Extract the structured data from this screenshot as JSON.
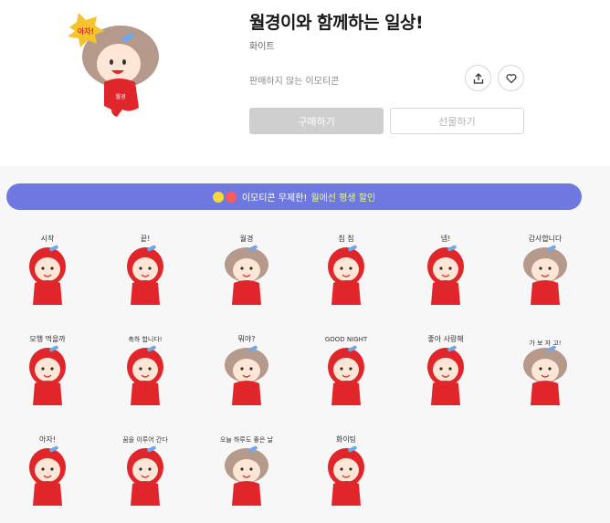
{
  "product": {
    "title": "월경이와 함께하는 일상!",
    "author": "화이트",
    "sale_status": "판매하지 않는 이모티콘"
  },
  "actions": {
    "buy_label": "구매하기",
    "gift_label": "선물하기",
    "share_icon": "share-icon",
    "like_icon": "heart-icon"
  },
  "banner": {
    "text": "이모티콘 무제한!",
    "highlight": "월에선 평생 할인"
  },
  "hero_sticker": {
    "bubble_text": "아자!",
    "shirt_text": "월경"
  },
  "stickers": [
    {
      "id": 1,
      "text": "시작"
    },
    {
      "id": 2,
      "text": "끝!"
    },
    {
      "id": 3,
      "text": "월경"
    },
    {
      "id": 4,
      "text": "침 침"
    },
    {
      "id": 5,
      "text": "넵!"
    },
    {
      "id": 6,
      "text": "감사합니다"
    },
    {
      "id": 7,
      "text": "모행 먹을까"
    },
    {
      "id": 8,
      "text": "축하 합니다!"
    },
    {
      "id": 9,
      "text": "뭐야?"
    },
    {
      "id": 10,
      "text": "GOOD NIGHT"
    },
    {
      "id": 11,
      "text": "좋아 사랑해"
    },
    {
      "id": 12,
      "text": "가 보 자 고!"
    },
    {
      "id": 13,
      "text": "아자!"
    },
    {
      "id": 14,
      "text": "꿈을 이루어 간다"
    },
    {
      "id": 15,
      "text": "오늘 하루도 좋은 날"
    },
    {
      "id": 16,
      "text": "화이팅"
    }
  ],
  "colors": {
    "accent": "#6f78e0",
    "sticker_red": "#e0262b",
    "skin": "#fde6d6",
    "hair": "#b5998a",
    "buy_disabled": "#cfcfcf",
    "gallery_bg": "#f7f7f7"
  }
}
